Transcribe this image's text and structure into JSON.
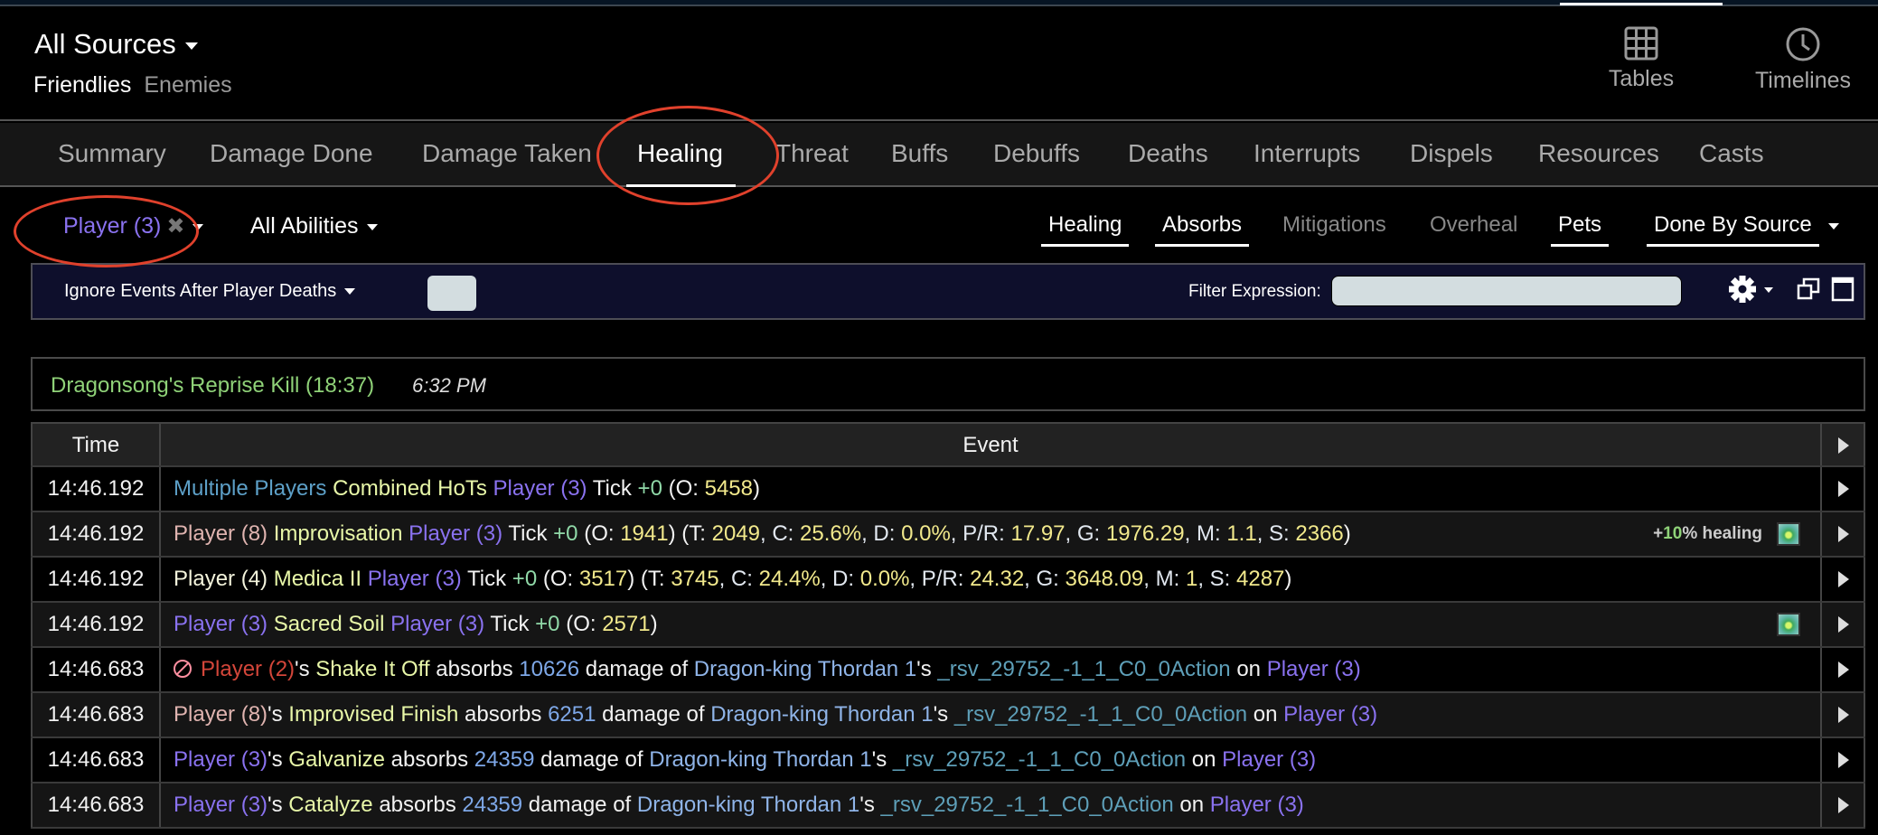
{
  "header": {
    "source_selector": "All Sources",
    "source_tabs": [
      {
        "label": "Friendlies",
        "active": true
      },
      {
        "label": "Enemies",
        "active": false
      }
    ],
    "views": [
      {
        "label": "Tables",
        "icon": "grid-icon"
      },
      {
        "label": "Timelines",
        "icon": "clock-icon"
      }
    ]
  },
  "tabs": [
    {
      "label": "Summary"
    },
    {
      "label": "Damage Done"
    },
    {
      "label": "Damage Taken"
    },
    {
      "label": "Healing",
      "active": true
    },
    {
      "label": "Threat"
    },
    {
      "label": "Buffs"
    },
    {
      "label": "Debuffs"
    },
    {
      "label": "Deaths"
    },
    {
      "label": "Interrupts"
    },
    {
      "label": "Dispels"
    },
    {
      "label": "Resources"
    },
    {
      "label": "Casts"
    }
  ],
  "filters": {
    "player": "Player (3)",
    "abilities": "All Abilities",
    "options": [
      {
        "label": "Healing",
        "on": true
      },
      {
        "label": "Absorbs",
        "on": true
      },
      {
        "label": "Mitigations",
        "on": false
      },
      {
        "label": "Overheal",
        "on": false
      },
      {
        "label": "Pets",
        "on": true
      }
    ],
    "mode": "Done By Source"
  },
  "options_bar": {
    "ignore_label": "Ignore Events After Player Deaths",
    "filter_label": "Filter Expression:",
    "filter_value": ""
  },
  "fight": {
    "name": "Dragonsong's Reprise Kill (18:37)",
    "time": "6:32 PM"
  },
  "table": {
    "columns": [
      "Time",
      "Event"
    ],
    "rows": [
      {
        "time": "14:46.192",
        "segments": [
          [
            "s-multi",
            "Multiple Players"
          ],
          [
            "s-white",
            " "
          ],
          [
            "s-abil",
            "Combined HoTs"
          ],
          [
            "s-white",
            " "
          ],
          [
            "s-pl3",
            "Player (3)"
          ],
          [
            "s-white",
            " Tick "
          ],
          [
            "s-plus",
            "+0"
          ],
          [
            "s-white",
            " (O: "
          ],
          [
            "s-num",
            "5458"
          ],
          [
            "s-white",
            ")"
          ]
        ]
      },
      {
        "time": "14:46.192",
        "bonus": {
          "prefix": "+",
          "pct": "10",
          "suffix": "% healing"
        },
        "icon": true,
        "segments": [
          [
            "s-pl8",
            "Player (8)"
          ],
          [
            "s-white",
            " "
          ],
          [
            "s-abil",
            "Improvisation"
          ],
          [
            "s-white",
            " "
          ],
          [
            "s-pl3",
            "Player (3)"
          ],
          [
            "s-white",
            " Tick "
          ],
          [
            "s-plus",
            "+0"
          ],
          [
            "s-white",
            " (O: "
          ],
          [
            "s-num",
            "1941"
          ],
          [
            "s-white",
            ") (T: "
          ],
          [
            "s-num",
            "2049"
          ],
          [
            "s-label",
            ", C: "
          ],
          [
            "s-num",
            "25.6%"
          ],
          [
            "s-label",
            ", D: "
          ],
          [
            "s-num",
            "0.0%"
          ],
          [
            "s-label",
            ", P/R: "
          ],
          [
            "s-num",
            "17.97"
          ],
          [
            "s-label",
            ", G: "
          ],
          [
            "s-num",
            "1976.29"
          ],
          [
            "s-label",
            ", M: "
          ],
          [
            "s-num",
            "1.1"
          ],
          [
            "s-label",
            ", S: "
          ],
          [
            "s-num",
            "2366"
          ],
          [
            "s-white",
            ")"
          ]
        ]
      },
      {
        "time": "14:46.192",
        "segments": [
          [
            "s-pl4",
            "Player (4)"
          ],
          [
            "s-white",
            " "
          ],
          [
            "s-abil",
            "Medica II"
          ],
          [
            "s-white",
            " "
          ],
          [
            "s-pl3",
            "Player (3)"
          ],
          [
            "s-white",
            " Tick "
          ],
          [
            "s-plus",
            "+0"
          ],
          [
            "s-white",
            " (O: "
          ],
          [
            "s-num",
            "3517"
          ],
          [
            "s-white",
            ") (T: "
          ],
          [
            "s-num",
            "3745"
          ],
          [
            "s-label",
            ", C: "
          ],
          [
            "s-num",
            "24.4%"
          ],
          [
            "s-label",
            ", D: "
          ],
          [
            "s-num",
            "0.0%"
          ],
          [
            "s-label",
            ", P/R: "
          ],
          [
            "s-num",
            "24.32"
          ],
          [
            "s-label",
            ", G: "
          ],
          [
            "s-num",
            "3648.09"
          ],
          [
            "s-label",
            ", M: "
          ],
          [
            "s-num",
            "1"
          ],
          [
            "s-label",
            ", S: "
          ],
          [
            "s-num",
            "4287"
          ],
          [
            "s-white",
            ")"
          ]
        ]
      },
      {
        "time": "14:46.192",
        "icon": true,
        "segments": [
          [
            "s-pl3",
            "Player (3)"
          ],
          [
            "s-white",
            " "
          ],
          [
            "s-abil",
            "Sacred Soil"
          ],
          [
            "s-white",
            " "
          ],
          [
            "s-pl3",
            "Player (3)"
          ],
          [
            "s-white",
            " Tick "
          ],
          [
            "s-plus",
            "+0"
          ],
          [
            "s-white",
            " (O: "
          ],
          [
            "s-num",
            "2571"
          ],
          [
            "s-white",
            ")"
          ]
        ]
      },
      {
        "time": "14:46.683",
        "debuff": true,
        "segments": [
          [
            "s-pl2",
            "Player (2)"
          ],
          [
            "s-white",
            "'s "
          ],
          [
            "s-abil",
            "Shake It Off"
          ],
          [
            "s-white",
            " absorbs "
          ],
          [
            "s-absnum",
            "10626"
          ],
          [
            "s-white",
            " damage of "
          ],
          [
            "s-enemy",
            "Dragon-king Thordan 1"
          ],
          [
            "s-white",
            "'s "
          ],
          [
            "s-action",
            "_rsv_29752_-1_1_C0_0Action"
          ],
          [
            "s-white",
            " on "
          ],
          [
            "s-pl3",
            "Player (3)"
          ]
        ]
      },
      {
        "time": "14:46.683",
        "segments": [
          [
            "s-pl8",
            "Player (8)"
          ],
          [
            "s-white",
            "'s "
          ],
          [
            "s-abil",
            "Improvised Finish"
          ],
          [
            "s-white",
            " absorbs "
          ],
          [
            "s-absnum",
            "6251"
          ],
          [
            "s-white",
            " damage of "
          ],
          [
            "s-enemy",
            "Dragon-king Thordan 1"
          ],
          [
            "s-white",
            "'s "
          ],
          [
            "s-action",
            "_rsv_29752_-1_1_C0_0Action"
          ],
          [
            "s-white",
            " on "
          ],
          [
            "s-pl3",
            "Player (3)"
          ]
        ]
      },
      {
        "time": "14:46.683",
        "segments": [
          [
            "s-pl3",
            "Player (3)"
          ],
          [
            "s-white",
            "'s "
          ],
          [
            "s-abil",
            "Galvanize"
          ],
          [
            "s-white",
            " absorbs "
          ],
          [
            "s-absnum",
            "24359"
          ],
          [
            "s-white",
            " damage of "
          ],
          [
            "s-enemy",
            "Dragon-king Thordan 1"
          ],
          [
            "s-white",
            "'s "
          ],
          [
            "s-action",
            "_rsv_29752_-1_1_C0_0Action"
          ],
          [
            "s-white",
            " on "
          ],
          [
            "s-pl3",
            "Player (3)"
          ]
        ]
      },
      {
        "time": "14:46.683",
        "segments": [
          [
            "s-pl3",
            "Player (3)"
          ],
          [
            "s-white",
            "'s "
          ],
          [
            "s-abil",
            "Catalyze"
          ],
          [
            "s-white",
            " absorbs "
          ],
          [
            "s-absnum",
            "24359"
          ],
          [
            "s-white",
            " damage of "
          ],
          [
            "s-enemy",
            "Dragon-king Thordan 1"
          ],
          [
            "s-white",
            "'s "
          ],
          [
            "s-action",
            "_rsv_29752_-1_1_C0_0Action"
          ],
          [
            "s-white",
            " on "
          ],
          [
            "s-pl3",
            "Player (3)"
          ]
        ]
      }
    ]
  },
  "colors": {
    "annotation_ring": "#e0412c",
    "player3": "#8a72f0",
    "ability": "#e8f7a8",
    "fight_name": "#8fd278"
  }
}
